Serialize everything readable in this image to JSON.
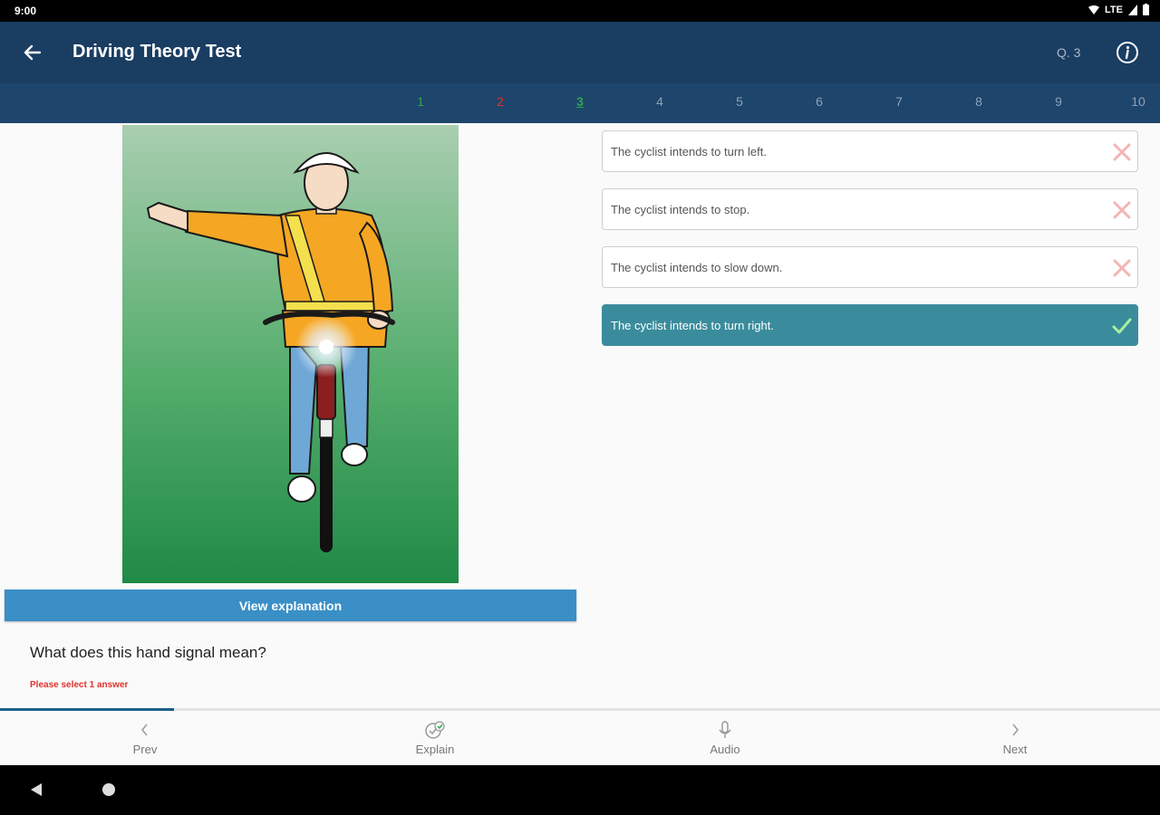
{
  "status": {
    "time": "9:00",
    "network": "LTE"
  },
  "header": {
    "title": "Driving Theory Test",
    "question_counter": "Q. 3"
  },
  "question_tabs": [
    {
      "label": "1",
      "state": "correct"
    },
    {
      "label": "2",
      "state": "wrong"
    },
    {
      "label": "3",
      "state": "current"
    },
    {
      "label": "4",
      "state": "pending"
    },
    {
      "label": "5",
      "state": "pending"
    },
    {
      "label": "6",
      "state": "pending"
    },
    {
      "label": "7",
      "state": "pending"
    },
    {
      "label": "8",
      "state": "pending"
    },
    {
      "label": "9",
      "state": "pending"
    },
    {
      "label": "10",
      "state": "pending"
    }
  ],
  "explain_button": "View explanation",
  "question": "What does this hand signal mean?",
  "hint": "Please select 1 answer",
  "answers": [
    {
      "text": "The cyclist intends to turn left.",
      "state": "wrong"
    },
    {
      "text": "The cyclist intends to stop.",
      "state": "wrong"
    },
    {
      "text": "The cyclist intends to slow down.",
      "state": "wrong"
    },
    {
      "text": "The cyclist intends to turn right.",
      "state": "correct"
    }
  ],
  "progress": 0.15,
  "bottom_nav": {
    "prev": "Prev",
    "explain": "Explain",
    "audio": "Audio",
    "next": "Next"
  },
  "colors": {
    "header": "#1a3d62",
    "correct": "#3a8c9c",
    "button": "#3a8fc7",
    "wrong": "#e0312a"
  }
}
